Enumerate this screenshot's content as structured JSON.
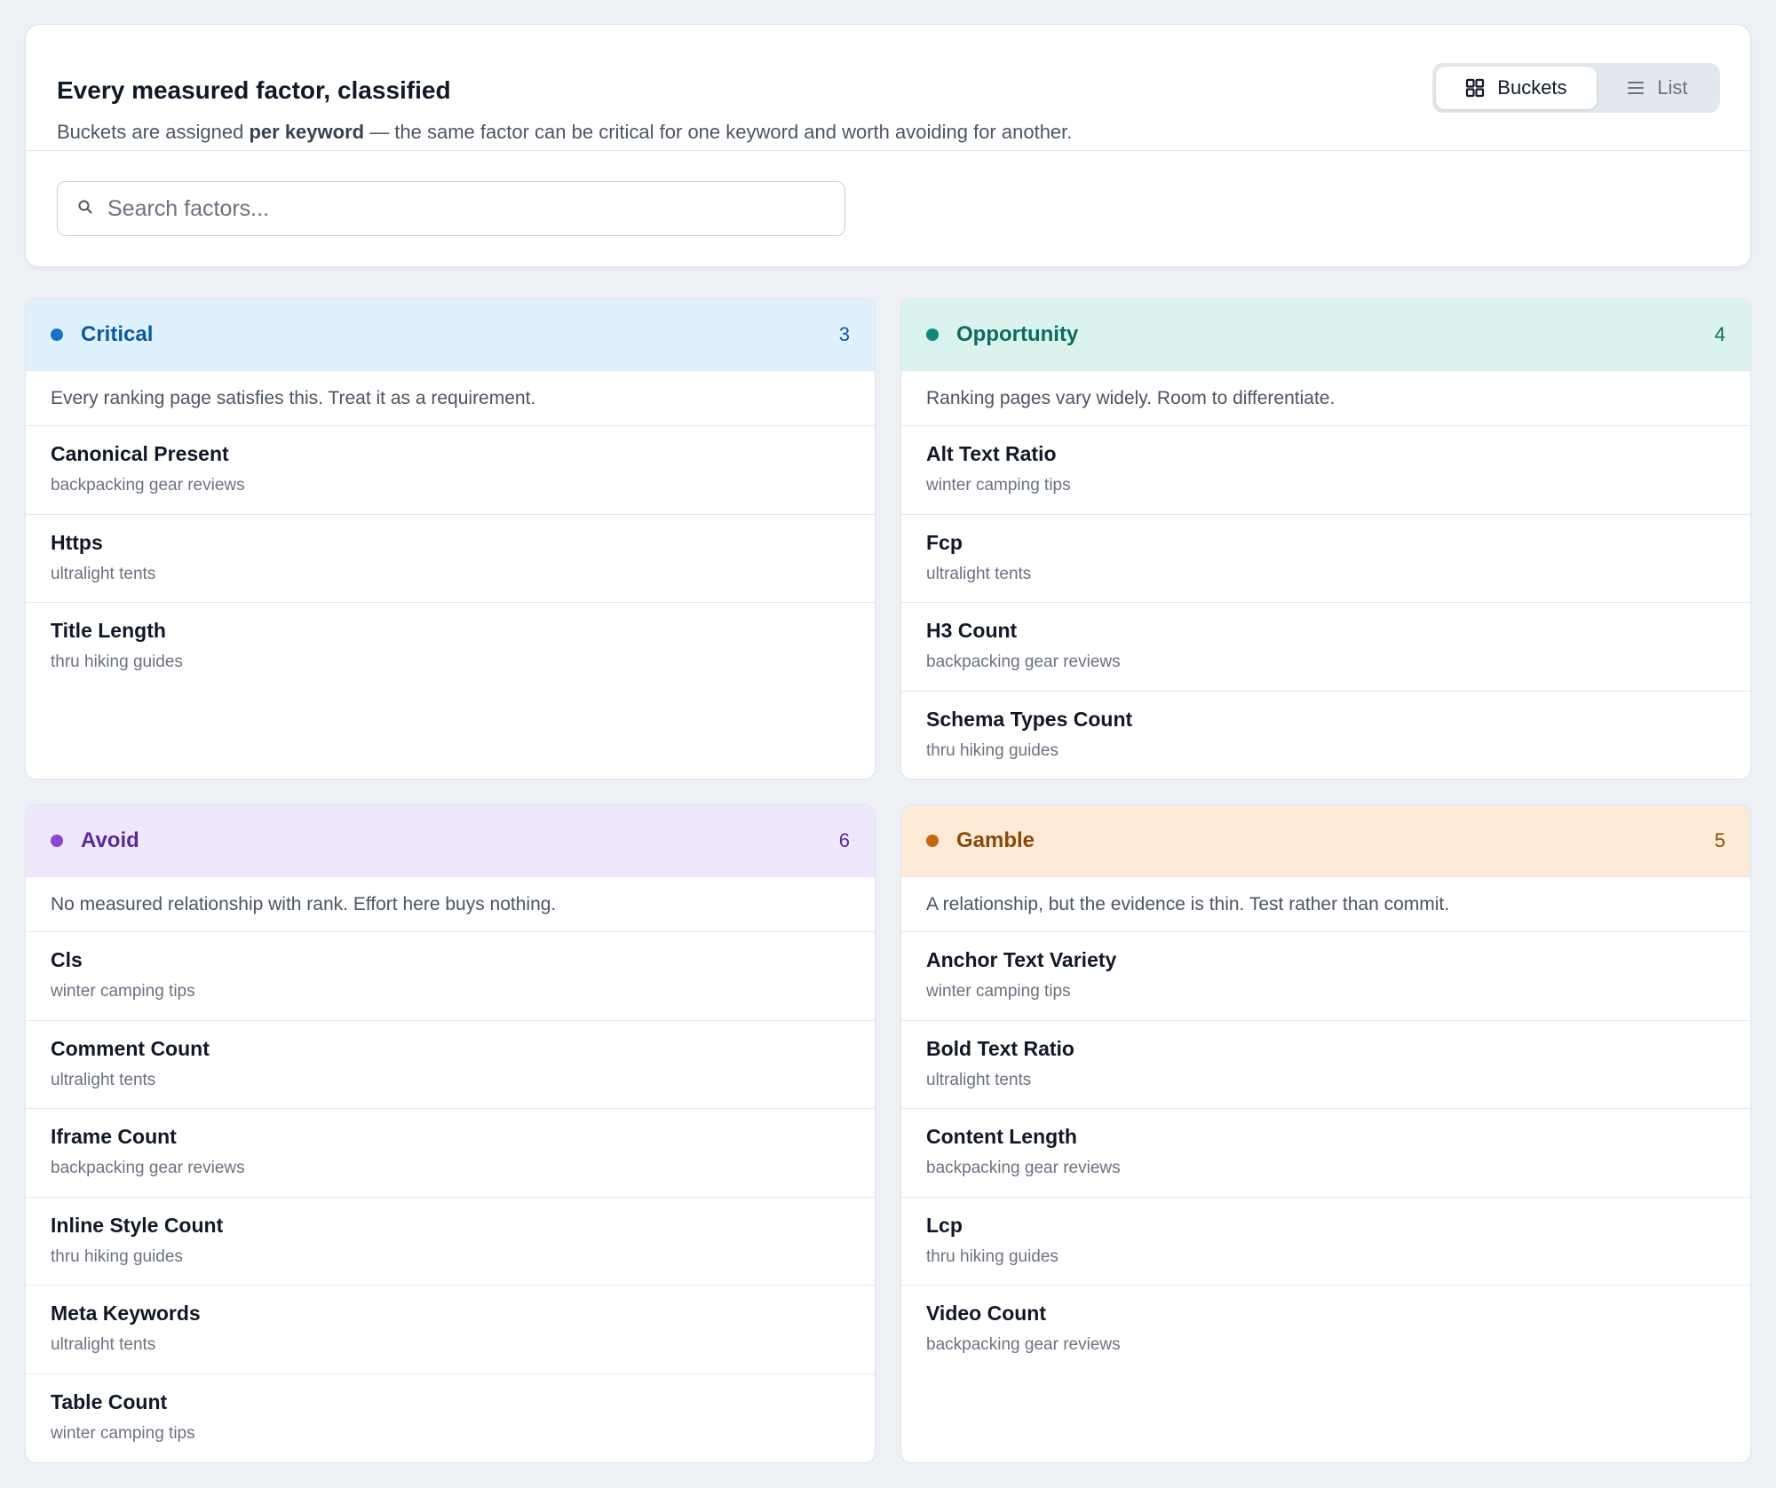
{
  "header": {
    "title": "Every measured factor, classified",
    "subtitle_pre": "Buckets are assigned ",
    "subtitle_bold": "per keyword",
    "subtitle_post": " — the same factor can be critical for one keyword and worth avoiding for another.",
    "view_toggle": {
      "buckets_label": "Buckets",
      "buckets_icon": "grid-icon",
      "list_label": "List",
      "list_icon": "list-icon",
      "active": "Buckets"
    }
  },
  "search": {
    "placeholder": "Search factors...",
    "value": "",
    "icon": "search-icon"
  },
  "buckets": {
    "critical": {
      "name": "Critical",
      "count": "3",
      "color": "#1773c7",
      "description": "Every ranking page satisfies this. Treat it as a requirement.",
      "factors": [
        {
          "name": "Canonical Present",
          "keyword": "backpacking gear reviews"
        },
        {
          "name": "Https",
          "keyword": "ultralight tents"
        },
        {
          "name": "Title Length",
          "keyword": "thru hiking guides"
        }
      ]
    },
    "opportunity": {
      "name": "Opportunity",
      "count": "4",
      "color": "#0f8a78",
      "description": "Ranking pages vary widely. Room to differentiate.",
      "factors": [
        {
          "name": "Alt Text Ratio",
          "keyword": "winter camping tips"
        },
        {
          "name": "Fcp",
          "keyword": "ultralight tents"
        },
        {
          "name": "H3 Count",
          "keyword": "backpacking gear reviews"
        },
        {
          "name": "Schema Types Count",
          "keyword": "thru hiking guides"
        }
      ]
    },
    "avoid": {
      "name": "Avoid",
      "count": "6",
      "color": "#8a48cf",
      "description": "No measured relationship with rank. Effort here buys nothing.",
      "factors": [
        {
          "name": "Cls",
          "keyword": "winter camping tips"
        },
        {
          "name": "Comment Count",
          "keyword": "ultralight tents"
        },
        {
          "name": "Iframe Count",
          "keyword": "backpacking gear reviews"
        },
        {
          "name": "Inline Style Count",
          "keyword": "thru hiking guides"
        },
        {
          "name": "Meta Keywords",
          "keyword": "ultralight tents"
        },
        {
          "name": "Table Count",
          "keyword": "winter camping tips"
        }
      ]
    },
    "gamble": {
      "name": "Gamble",
      "count": "5",
      "color": "#c4680e",
      "description": "A relationship, but the evidence is thin. Test rather than commit.",
      "factors": [
        {
          "name": "Anchor Text Variety",
          "keyword": "winter camping tips"
        },
        {
          "name": "Bold Text Ratio",
          "keyword": "ultralight tents"
        },
        {
          "name": "Content Length",
          "keyword": "backpacking gear reviews"
        },
        {
          "name": "Lcp",
          "keyword": "thru hiking guides"
        },
        {
          "name": "Video Count",
          "keyword": "backpacking gear reviews"
        }
      ]
    }
  }
}
